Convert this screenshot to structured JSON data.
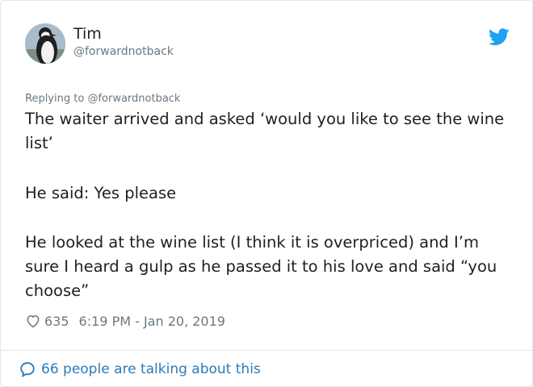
{
  "author": {
    "display_name": "Tim",
    "handle": "@forwardnotback",
    "avatar_icon": "penguin-avatar"
  },
  "brand": {
    "icon": "twitter-bird-icon",
    "color": "#1da1f2"
  },
  "reply": {
    "prefix": "Replying to ",
    "to_handle": "@forwardnotback"
  },
  "tweet": {
    "paragraphs": [
      "The waiter arrived and asked ‘would you like to see the wine list’",
      "He said: Yes please",
      "He looked at the wine list (I think it is overpriced) and I’m sure I heard a gulp as he passed it to his love and said “you choose”"
    ]
  },
  "meta": {
    "like_icon": "heart-icon",
    "likes": "635",
    "timestamp": "6:19 PM - Jan 20, 2019"
  },
  "footer": {
    "icon": "speech-bubble-icon",
    "talking_text": "66 people are talking about this",
    "link_color": "#2b7bb9"
  }
}
